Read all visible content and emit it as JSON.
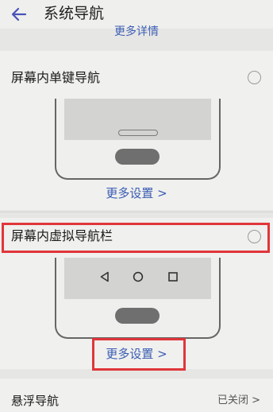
{
  "header": {
    "title": "系统导航",
    "back_icon": "arrow-left-icon"
  },
  "top_more_link": "更多详情",
  "options": [
    {
      "label": "屏幕内单键导航",
      "selected": false,
      "more_settings": "更多设置 >"
    },
    {
      "label": "屏幕内虚拟导航栏",
      "selected": false,
      "more_settings": "更多设置 >"
    }
  ],
  "floating_nav": {
    "label": "悬浮导航",
    "value": "已关闭 >"
  },
  "colors": {
    "accent": "#3a5cb3",
    "highlight": "#e0363a",
    "background": "#e6e6e4"
  }
}
